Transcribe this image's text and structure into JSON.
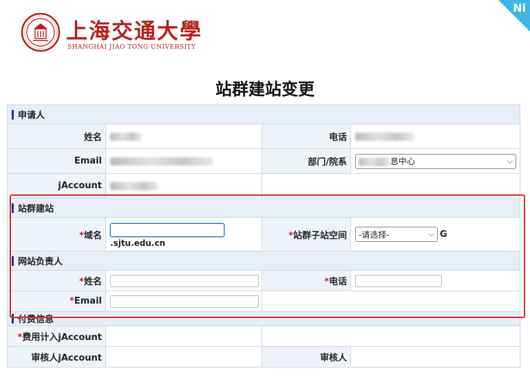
{
  "logo": {
    "cn_name": "上海交通大學",
    "en_name": "SHANGHAI JIAO TONG UNIVERSITY"
  },
  "page_title": "站群建站变更",
  "sections": {
    "applicant": "申请人",
    "site_build": "站群建站",
    "site_owner": "网站负责人",
    "payment": "付费信息"
  },
  "applicant": {
    "name_label": "姓名",
    "phone_label": "电话",
    "email_label": "Email",
    "dept_label": "部门/院系",
    "dept_selected_visible": "息中心",
    "jaccount_label": "jAccount"
  },
  "site_build": {
    "domain_label": "域名",
    "domain_suffix": ".sjtu.edu.cn",
    "space_label": "站群子站空间",
    "space_selected": "-请选择-",
    "space_unit": "G"
  },
  "site_owner": {
    "name_label": "姓名",
    "phone_label": "电话",
    "email_label": "Email"
  },
  "payment": {
    "fee_jaccount_label": "费用计入jAccount",
    "reviewer_jaccount_label": "审核人jAccount",
    "reviewer_label": "审核人"
  },
  "required_mark": "*",
  "colors": {
    "brand_red": "#b3201e",
    "highlight_red": "#e0282a",
    "section_bar": "#1e3f7a",
    "corner_accent": "#3fb6e8"
  }
}
